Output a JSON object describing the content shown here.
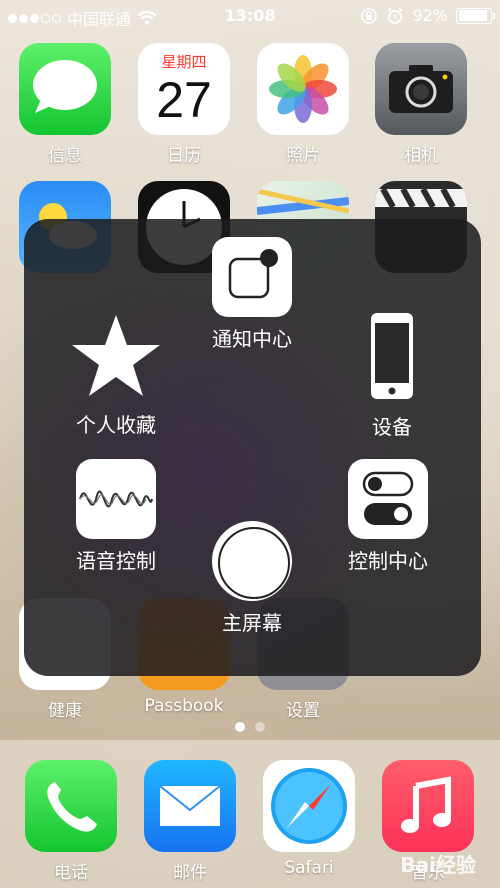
{
  "status_bar": {
    "carrier": "中国联通",
    "time": "13:08",
    "battery_percent": "92%",
    "battery_level": 0.92,
    "signal_bars_filled": 3,
    "signal_bars_total": 5
  },
  "home": {
    "row1": [
      {
        "label": "信息",
        "icon": "messages-icon"
      },
      {
        "label": "日历",
        "icon": "calendar-icon",
        "weekday": "星期四",
        "day": "27"
      },
      {
        "label": "照片",
        "icon": "photos-icon"
      },
      {
        "label": "相机",
        "icon": "camera-icon"
      }
    ],
    "row4": [
      {
        "label": "健康"
      },
      {
        "label": "Passbook"
      },
      {
        "label": "设置"
      }
    ],
    "page_count": 2,
    "current_page": 1
  },
  "dock": [
    {
      "label": "电话",
      "icon": "phone-icon"
    },
    {
      "label": "邮件",
      "icon": "mail-icon"
    },
    {
      "label": "Safari",
      "icon": "safari-icon"
    },
    {
      "label": "音乐",
      "icon": "music-icon"
    }
  ],
  "assistive_touch": {
    "notification_center": "通知中心",
    "favorites": "个人收藏",
    "device": "设备",
    "siri": "语音控制",
    "control_center": "控制中心",
    "home": "主屏幕"
  },
  "watermark": "Bai经验"
}
